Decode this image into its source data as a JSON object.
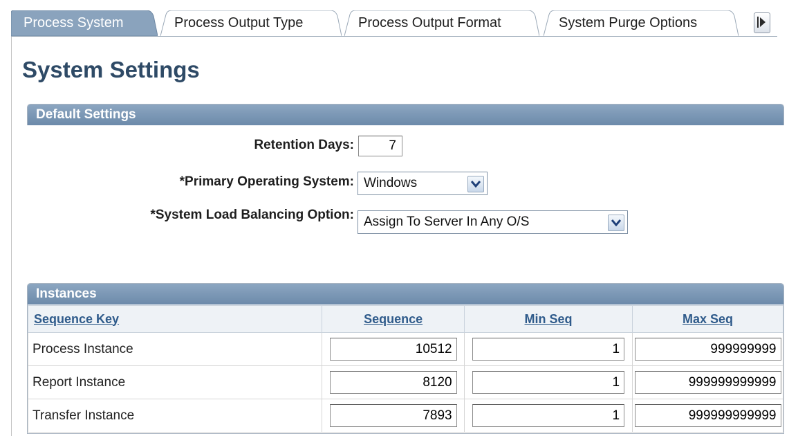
{
  "tabs": [
    {
      "label": "Process System",
      "active": true
    },
    {
      "label": "Process Output Type",
      "active": false
    },
    {
      "label": "Process Output Format",
      "active": false
    },
    {
      "label": "System Purge Options",
      "active": false
    }
  ],
  "page_title": "System Settings",
  "default_settings": {
    "header": "Default Settings",
    "retention_days": {
      "label": "Retention Days:",
      "value": "7"
    },
    "primary_os": {
      "label": "*Primary Operating System:",
      "value": "Windows"
    },
    "load_balancing": {
      "label": "*System Load Balancing Option:",
      "value": "Assign To Server In Any O/S"
    }
  },
  "instances": {
    "header": "Instances",
    "columns": [
      "Sequence Key",
      "Sequence",
      "Min Seq",
      "Max Seq"
    ],
    "rows": [
      {
        "key": "Process Instance",
        "sequence": "10512",
        "min": "1",
        "max": "999999999"
      },
      {
        "key": "Report Instance",
        "sequence": "8120",
        "min": "1",
        "max": "999999999999"
      },
      {
        "key": "Transfer Instance",
        "sequence": "7893",
        "min": "1",
        "max": "999999999999"
      }
    ]
  },
  "colors": {
    "active_tab": "#8aa3bd",
    "title": "#2e4a66",
    "group_header": "#7d98b5",
    "link": "#2f5b8b"
  },
  "icons": {
    "tab_scroll": "right-arrow-icon",
    "dropdown": "chevron-down-icon"
  }
}
